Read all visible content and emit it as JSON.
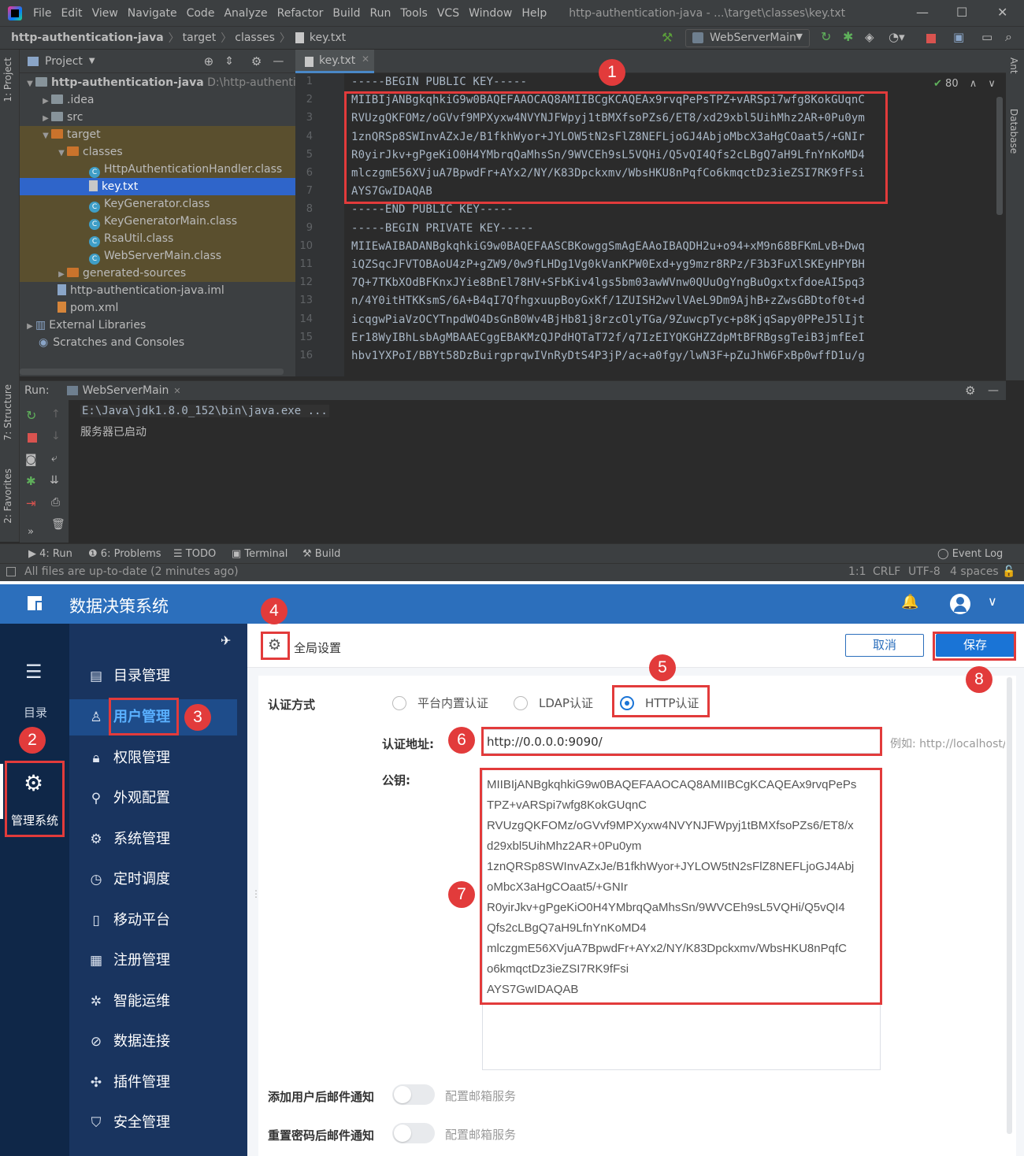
{
  "ide": {
    "menu": [
      "File",
      "Edit",
      "View",
      "Navigate",
      "Code",
      "Analyze",
      "Refactor",
      "Build",
      "Run",
      "Tools",
      "VCS",
      "Window",
      "Help"
    ],
    "window_title": "http-authentication-java - ...\\target\\classes\\key.txt",
    "breadcrumb": [
      "http-authentication-java",
      "target",
      "classes",
      "key.txt"
    ],
    "run_config": "WebServerMain",
    "project_header": "Project",
    "tree": [
      {
        "label": "http-authentication-java",
        "extra": "D:\\http-authenticatic"
      },
      {
        "label": ".idea"
      },
      {
        "label": "src"
      },
      {
        "label": "target"
      },
      {
        "label": "classes"
      },
      {
        "label": "HttpAuthenticationHandler.class"
      },
      {
        "label": "key.txt"
      },
      {
        "label": "KeyGenerator.class"
      },
      {
        "label": "KeyGeneratorMain.class"
      },
      {
        "label": "RsaUtil.class"
      },
      {
        "label": "WebServerMain.class"
      },
      {
        "label": "generated-sources"
      },
      {
        "label": "http-authentication-java.iml"
      },
      {
        "label": "pom.xml"
      },
      {
        "label": "External Libraries"
      },
      {
        "label": "Scratches and Consoles"
      }
    ],
    "editor_tab": "key.txt",
    "inspection_count": "80",
    "code_lines": [
      "-----BEGIN PUBLIC KEY-----",
      "MIIBIjANBgkqhkiG9w0BAQEFAAOCAQ8AMIIBCgKCAQEAx9rvqPePsTPZ+vARSpi7wfg8KokGUqnC",
      "RVUzgQKFOMz/oGVvf9MPXyxw4NVYNJFWpyj1tBMXfsoPZs6/ET8/xd29xbl5UihMhz2AR+0Pu0ym",
      "1znQRSp8SWInvAZxJe/B1fkhWyor+JYLOW5tN2sFlZ8NEFLjoGJ4AbjoMbcX3aHgCOaat5/+GNIr",
      "R0yirJkv+gPgeKiO0H4YMbrqQaMhsSn/9WVCEh9sL5VQHi/Q5vQI4Qfs2cLBgQ7aH9LfnYnKoMD4",
      "mlczgmE56XVjuA7BpwdFr+AYx2/NY/K83Dpckxmv/WbsHKU8nPqfCo6kmqctDz3ieZSI7RK9fFsi",
      "AYS7GwIDAQAB",
      "-----END PUBLIC KEY-----",
      "-----BEGIN PRIVATE KEY-----",
      "MIIEwAIBADANBgkqhkiG9w0BAQEFAASCBKowggSmAgEAAoIBAQDH2u+o94+xM9n68BFKmLvB+Dwq",
      "iQZSqcJFVTOBAoU4zP+gZW9/0w9fLHDg1Vg0kVanKPW0Exd+yg9mzr8RPz/F3b3FuXlSKEyHPYBH",
      "7Q+7TKbXOdBFKnxJYie8BnEl78HV+SFbKiv4lgs5bm03awWVnw0QUuOgYngBuOgxtxfdoeAI5pq3",
      "n/4Y0itHTKKsmS/6A+B4qI7QfhgxuupBoyGxKf/1ZUISH2wvlVAeL9Dm9AjhB+zZwsGBDtof0t+d",
      "icqgwPiaVzOCYTnpdWO4DsGnB0Wv4BjHb81j8rzcOlyTGa/9ZuwcpTyc+p8KjqSapy0PPeJ5lIjt",
      "Er18WyIBhLsbAgMBAAECggEBAKMzQJPdHQTaT72f/q7IzEIYQKGHZZdpMtBFRBgsgTeiB3jmfEeI",
      "hbv1YXPoI/BBYt58DzBuirgprqwIVnRyDtS4P3jP/ac+a0fgy/lwN3F+pZuJhW6FxBp0wffD1u/g"
    ],
    "run_label": "Run:",
    "run_tab": "WebServerMain",
    "console": [
      "E:\\Java\\jdk1.8.0_152\\bin\\java.exe ...",
      "服务器已启动"
    ],
    "bottom_tabs": [
      "4: Run",
      "6: Problems",
      "TODO",
      "Terminal",
      "Build"
    ],
    "event_log": "Event Log",
    "status_left": "All files are up-to-date (2 minutes ago)",
    "status_right": [
      "1:1",
      "CRLF",
      "UTF-8",
      "4 spaces"
    ],
    "side_tabs": {
      "project": "1: Project",
      "structure": "7: Structure",
      "favorites": "2: Favorites",
      "ant": "Ant",
      "database": "Database"
    }
  },
  "web": {
    "brand": "数据决策系统",
    "left_nav": {
      "catalog": "目录",
      "manage": "管理系统"
    },
    "sub_nav": [
      "目录管理",
      "用户管理",
      "权限管理",
      "外观配置",
      "系统管理",
      "定时调度",
      "移动平台",
      "注册管理",
      "智能运维",
      "数据连接",
      "插件管理",
      "安全管理"
    ],
    "header_title": "全局设置",
    "cancel": "取消",
    "save": "保存",
    "auth_label": "认证方式",
    "auth_options": [
      "平台内置认证",
      "LDAP认证",
      "HTTP认证"
    ],
    "auth_selected": "HTTP认证",
    "addr_label": "认证地址:",
    "addr_value": "http://0.0.0.0:9090/",
    "addr_hint": "例如: http://localhost/s",
    "pubkey_label": "公钥:",
    "pubkey_lines": [
      "MIIBIjANBgkqhkiG9w0BAQEFAAOCAQ8AMIIBCgKCAQEAx9rvqPePs",
      "TPZ+vARSpi7wfg8KokGUqnC",
      "RVUzgQKFOMz/oGVvf9MPXyxw4NVYNJFWpyj1tBMXfsoPZs6/ET8/x",
      "d29xbl5UihMhz2AR+0Pu0ym",
      "1znQRSp8SWInvAZxJe/B1fkhWyor+JYLOW5tN2sFlZ8NEFLjoGJ4Abj",
      "oMbcX3aHgCOaat5/+GNIr",
      "R0yirJkv+gPgeKiO0H4YMbrqQaMhsSn/9WVCEh9sL5VQHi/Q5vQI4",
      "Qfs2cLBgQ7aH9LfnYnKoMD4",
      "mlczgmE56XVjuA7BpwdFr+AYx2/NY/K83Dpckxmv/WbsHKU8nPqfC",
      "o6kmqctDz3ieZSI7RK9fFsi",
      "AYS7GwIDAQAB"
    ],
    "mail1_label": "添加用户后邮件通知",
    "mail2_label": "重置密码后邮件通知",
    "mail_link": "配置邮箱服务"
  },
  "badges": [
    "1",
    "2",
    "3",
    "4",
    "5",
    "6",
    "7",
    "8"
  ],
  "colors": {
    "annotation": "#e23b3b",
    "web_primary": "#2c6fbc",
    "ide_selection": "#2f65ca"
  }
}
